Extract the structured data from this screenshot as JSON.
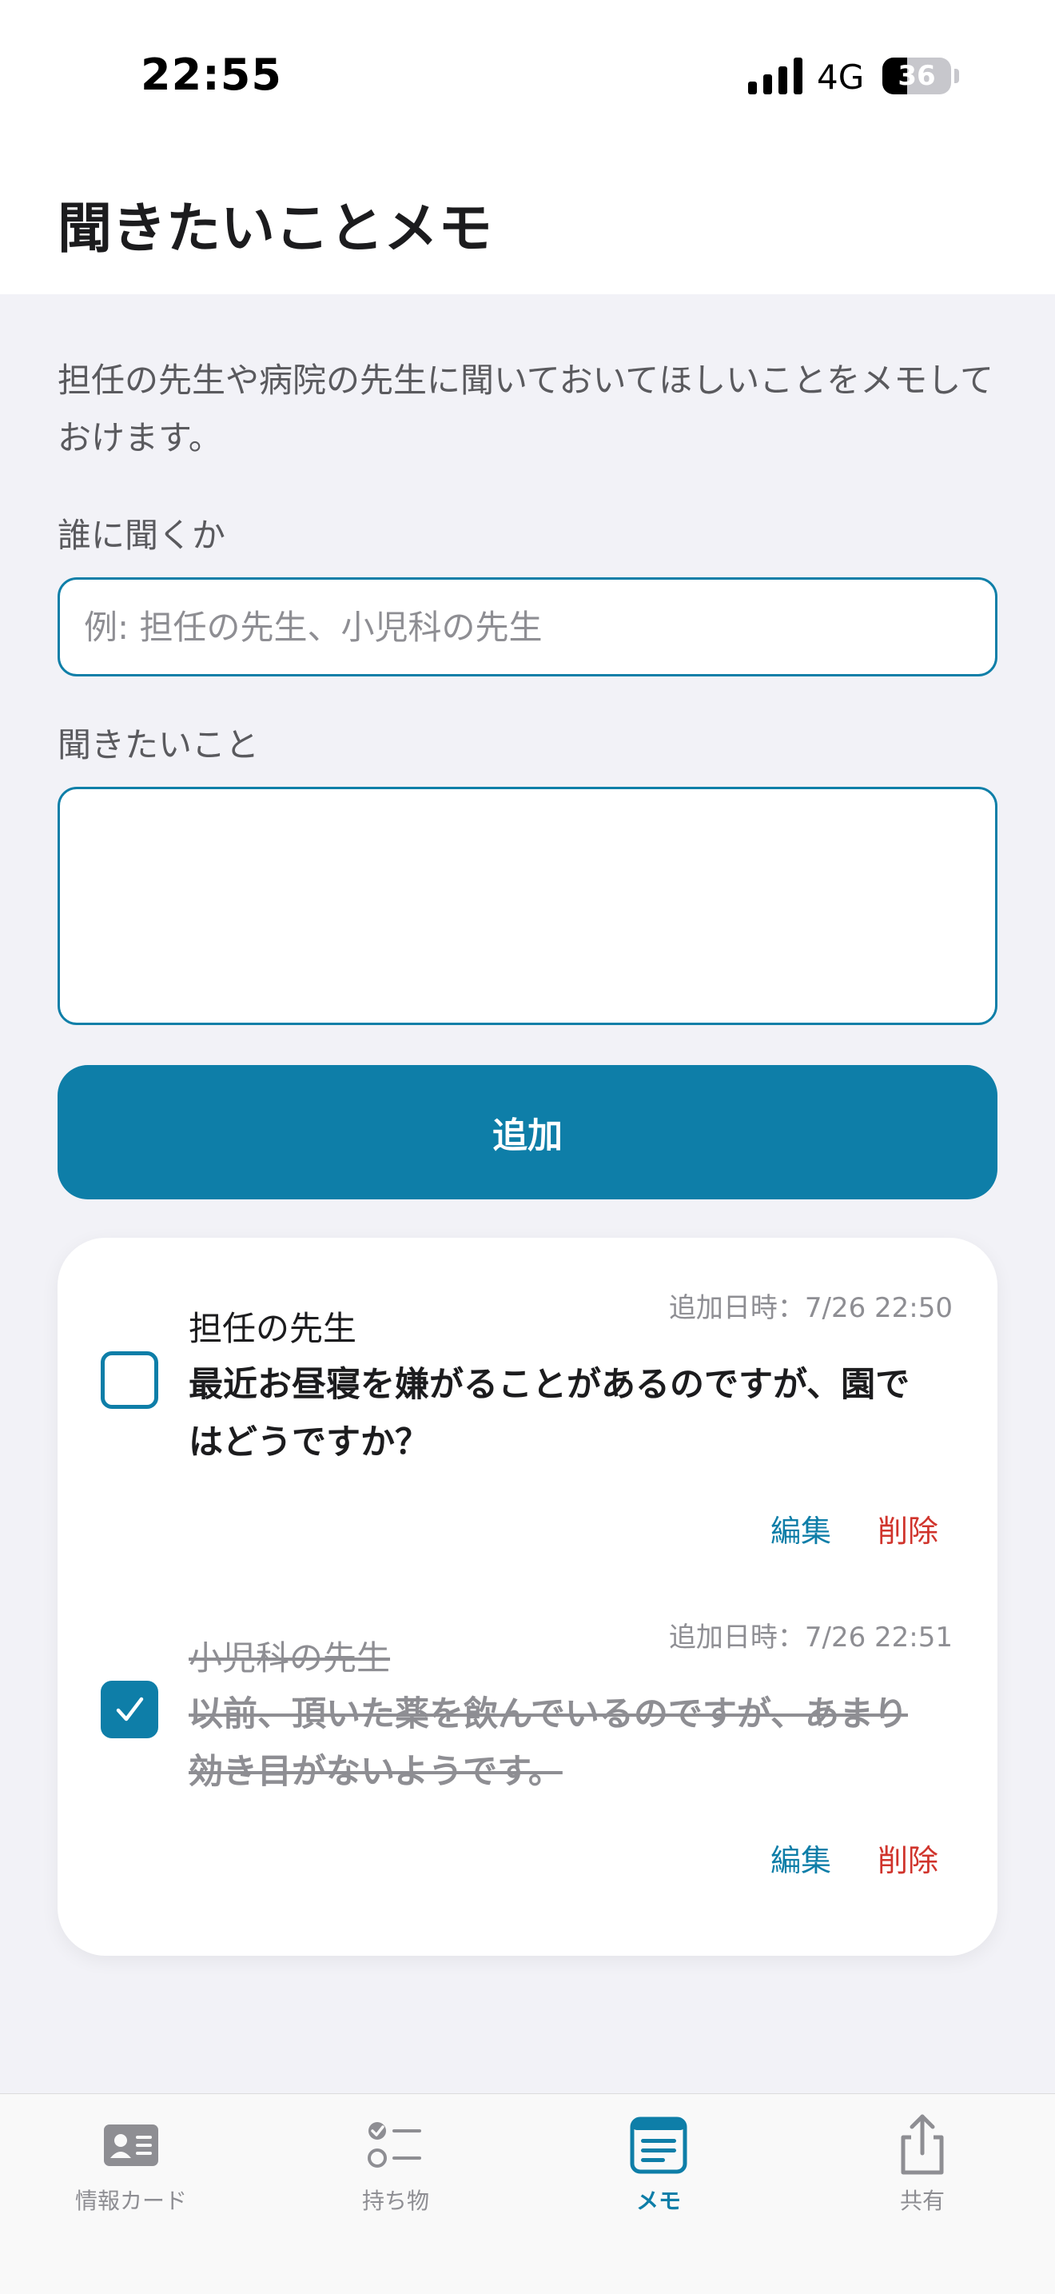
{
  "status_bar": {
    "time": "22:55",
    "network": "4G",
    "battery_level": "36",
    "battery_percent": 36
  },
  "header": {
    "title": "聞きたいことメモ"
  },
  "form": {
    "description": "担任の先生や病院の先生に聞いておいてほしいことをメモしておけます。",
    "who_label": "誰に聞くか",
    "who_placeholder": "例: 担任の先生、小児科の先生",
    "who_value": "",
    "question_label": "聞きたいこと",
    "question_value": "",
    "add_button": "追加"
  },
  "memos": [
    {
      "date": "追加日時：7/26 22:50",
      "who": "担任の先生",
      "text": "最近お昼寝を嫌がることがあるのですが、園ではどうですか？",
      "checked": false,
      "edit": "編集",
      "delete": "削除"
    },
    {
      "date": "追加日時：7/26 22:51",
      "who": "小児科の先生",
      "text": "以前、頂いた薬を飲んでいるのですが、あまり効き目がないようです。",
      "checked": true,
      "edit": "編集",
      "delete": "削除"
    }
  ],
  "tabs": [
    {
      "label": "情報カード",
      "icon": "id-card-icon",
      "active": false
    },
    {
      "label": "持ち物",
      "icon": "checklist-icon",
      "active": false
    },
    {
      "label": "メモ",
      "icon": "memo-icon",
      "active": true
    },
    {
      "label": "共有",
      "icon": "share-icon",
      "active": false
    }
  ],
  "colors": {
    "accent": "#0e7ea8",
    "danger": "#d0342c",
    "muted": "#8e8e93",
    "background": "#f2f2f7"
  }
}
